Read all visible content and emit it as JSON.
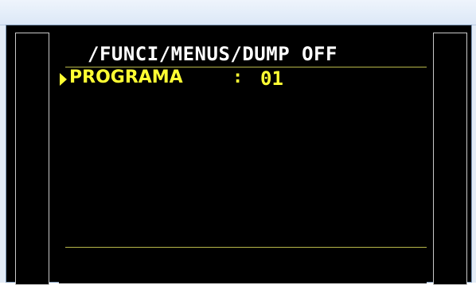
{
  "screen": {
    "title": "/FUNCI/MENUS/DUMP OFF",
    "rows": [
      {
        "label": "PROGRAMA",
        "separator": ":",
        "value": "01",
        "selected": true
      }
    ]
  },
  "colors": {
    "background": "#000000",
    "title": "#ffffff",
    "highlight": "#ffff33",
    "rule": "#b7b74a"
  }
}
